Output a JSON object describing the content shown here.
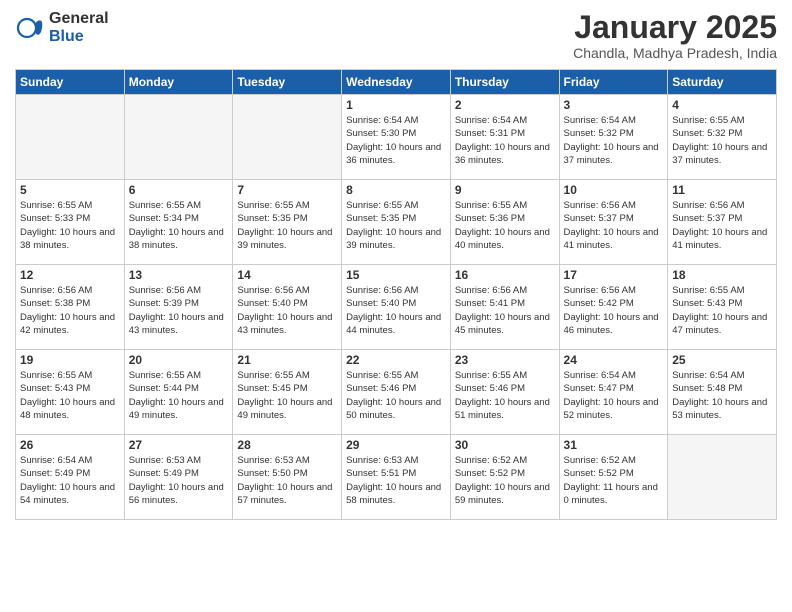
{
  "header": {
    "logo": {
      "general": "General",
      "blue": "Blue"
    },
    "title": "January 2025",
    "location": "Chandla, Madhya Pradesh, India"
  },
  "weekdays": [
    "Sunday",
    "Monday",
    "Tuesday",
    "Wednesday",
    "Thursday",
    "Friday",
    "Saturday"
  ],
  "weeks": [
    [
      {
        "day": "",
        "empty": true
      },
      {
        "day": "",
        "empty": true
      },
      {
        "day": "",
        "empty": true
      },
      {
        "day": "1",
        "sunrise": "6:54 AM",
        "sunset": "5:30 PM",
        "daylight": "10 hours and 36 minutes."
      },
      {
        "day": "2",
        "sunrise": "6:54 AM",
        "sunset": "5:31 PM",
        "daylight": "10 hours and 36 minutes."
      },
      {
        "day": "3",
        "sunrise": "6:54 AM",
        "sunset": "5:32 PM",
        "daylight": "10 hours and 37 minutes."
      },
      {
        "day": "4",
        "sunrise": "6:55 AM",
        "sunset": "5:32 PM",
        "daylight": "10 hours and 37 minutes."
      }
    ],
    [
      {
        "day": "5",
        "sunrise": "6:55 AM",
        "sunset": "5:33 PM",
        "daylight": "10 hours and 38 minutes."
      },
      {
        "day": "6",
        "sunrise": "6:55 AM",
        "sunset": "5:34 PM",
        "daylight": "10 hours and 38 minutes."
      },
      {
        "day": "7",
        "sunrise": "6:55 AM",
        "sunset": "5:35 PM",
        "daylight": "10 hours and 39 minutes."
      },
      {
        "day": "8",
        "sunrise": "6:55 AM",
        "sunset": "5:35 PM",
        "daylight": "10 hours and 39 minutes."
      },
      {
        "day": "9",
        "sunrise": "6:55 AM",
        "sunset": "5:36 PM",
        "daylight": "10 hours and 40 minutes."
      },
      {
        "day": "10",
        "sunrise": "6:56 AM",
        "sunset": "5:37 PM",
        "daylight": "10 hours and 41 minutes."
      },
      {
        "day": "11",
        "sunrise": "6:56 AM",
        "sunset": "5:37 PM",
        "daylight": "10 hours and 41 minutes."
      }
    ],
    [
      {
        "day": "12",
        "sunrise": "6:56 AM",
        "sunset": "5:38 PM",
        "daylight": "10 hours and 42 minutes."
      },
      {
        "day": "13",
        "sunrise": "6:56 AM",
        "sunset": "5:39 PM",
        "daylight": "10 hours and 43 minutes."
      },
      {
        "day": "14",
        "sunrise": "6:56 AM",
        "sunset": "5:40 PM",
        "daylight": "10 hours and 43 minutes."
      },
      {
        "day": "15",
        "sunrise": "6:56 AM",
        "sunset": "5:40 PM",
        "daylight": "10 hours and 44 minutes."
      },
      {
        "day": "16",
        "sunrise": "6:56 AM",
        "sunset": "5:41 PM",
        "daylight": "10 hours and 45 minutes."
      },
      {
        "day": "17",
        "sunrise": "6:56 AM",
        "sunset": "5:42 PM",
        "daylight": "10 hours and 46 minutes."
      },
      {
        "day": "18",
        "sunrise": "6:55 AM",
        "sunset": "5:43 PM",
        "daylight": "10 hours and 47 minutes."
      }
    ],
    [
      {
        "day": "19",
        "sunrise": "6:55 AM",
        "sunset": "5:43 PM",
        "daylight": "10 hours and 48 minutes."
      },
      {
        "day": "20",
        "sunrise": "6:55 AM",
        "sunset": "5:44 PM",
        "daylight": "10 hours and 49 minutes."
      },
      {
        "day": "21",
        "sunrise": "6:55 AM",
        "sunset": "5:45 PM",
        "daylight": "10 hours and 49 minutes."
      },
      {
        "day": "22",
        "sunrise": "6:55 AM",
        "sunset": "5:46 PM",
        "daylight": "10 hours and 50 minutes."
      },
      {
        "day": "23",
        "sunrise": "6:55 AM",
        "sunset": "5:46 PM",
        "daylight": "10 hours and 51 minutes."
      },
      {
        "day": "24",
        "sunrise": "6:54 AM",
        "sunset": "5:47 PM",
        "daylight": "10 hours and 52 minutes."
      },
      {
        "day": "25",
        "sunrise": "6:54 AM",
        "sunset": "5:48 PM",
        "daylight": "10 hours and 53 minutes."
      }
    ],
    [
      {
        "day": "26",
        "sunrise": "6:54 AM",
        "sunset": "5:49 PM",
        "daylight": "10 hours and 54 minutes."
      },
      {
        "day": "27",
        "sunrise": "6:53 AM",
        "sunset": "5:49 PM",
        "daylight": "10 hours and 56 minutes."
      },
      {
        "day": "28",
        "sunrise": "6:53 AM",
        "sunset": "5:50 PM",
        "daylight": "10 hours and 57 minutes."
      },
      {
        "day": "29",
        "sunrise": "6:53 AM",
        "sunset": "5:51 PM",
        "daylight": "10 hours and 58 minutes."
      },
      {
        "day": "30",
        "sunrise": "6:52 AM",
        "sunset": "5:52 PM",
        "daylight": "10 hours and 59 minutes."
      },
      {
        "day": "31",
        "sunrise": "6:52 AM",
        "sunset": "5:52 PM",
        "daylight": "11 hours and 0 minutes."
      },
      {
        "day": "",
        "empty": true
      }
    ]
  ]
}
